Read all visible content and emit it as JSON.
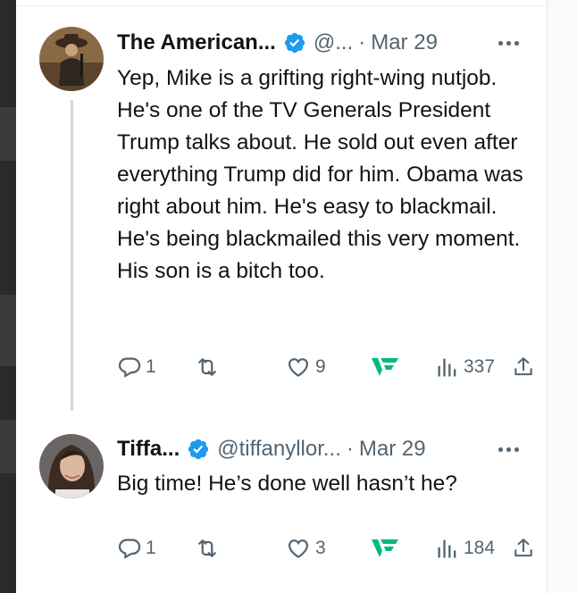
{
  "tweets": [
    {
      "display_name": "The American...",
      "handle": "@...",
      "separator": "·",
      "date": "Mar 29",
      "text": "Yep, Mike is a grifting right-wing nutjob. He's one of the TV Generals President Trump talks about. He sold out even after everything Trump did for him. Obama was right about him. He's easy to blackmail. He's being blackmailed this very moment. His son is a bitch too.",
      "replies": "1",
      "reposts": "",
      "likes": "9",
      "views": "337"
    },
    {
      "display_name": "Tiffa...",
      "handle": "@tiffanyllor...",
      "separator": "·",
      "date": "Mar 29",
      "text": "Big time! He’s done well hasn’t he?",
      "replies": "1",
      "reposts": "",
      "likes": "3",
      "views": "184"
    }
  ],
  "colors": {
    "text": "#0f1419",
    "muted": "#536471",
    "verified": "#1d9bf0",
    "app_icon": "#00ba7c"
  },
  "icons": [
    "verified-badge-icon",
    "more-icon",
    "reply-icon",
    "repost-icon",
    "like-icon",
    "app-icon",
    "views-icon",
    "share-icon"
  ]
}
